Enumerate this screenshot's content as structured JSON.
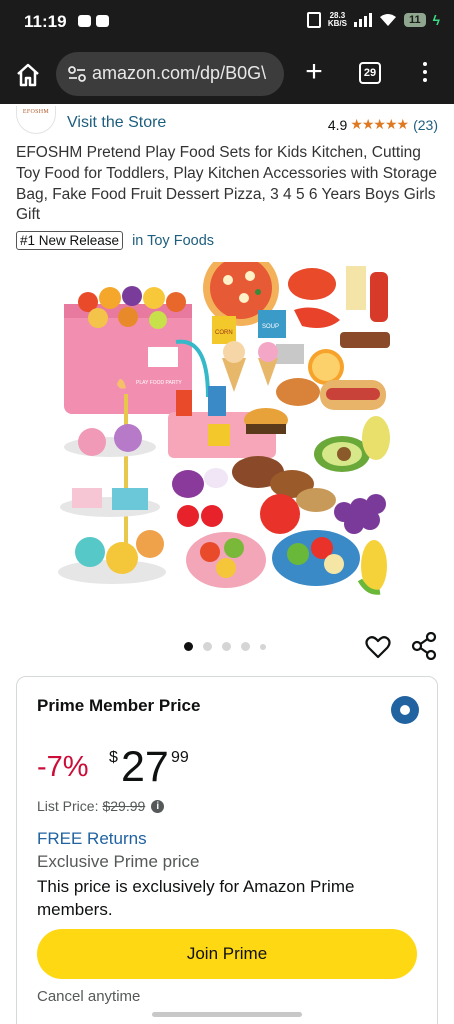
{
  "status_bar": {
    "time": "11:19",
    "net_speed_value": "28.3",
    "net_speed_unit": "KB/S",
    "battery": "11"
  },
  "browser": {
    "url": "amazon.com/dp/B0G\\",
    "tab_count": "29"
  },
  "store": {
    "logo_text": "EFOSHM",
    "visit_label": "Visit the Store",
    "rating_value": "4.9",
    "stars": "★★★★★",
    "rating_count": "(23)"
  },
  "product": {
    "title": "EFOSHM Pretend Play Food Sets for Kids Kitchen, Cutting Toy Food for Toddlers, Play Kitchen Accessories with Storage Bag, Fake Food Fruit Dessert Pizza, 3 4 5 6 Years Boys Girls Gift",
    "badge": "#1 New Release",
    "badge_category": "in Toy Foods",
    "image_bag_text": "PLAY FOOD PARTY",
    "image_can_text": "CORN",
    "image_can_text_2": "SOUP"
  },
  "offer": {
    "heading": "Prime Member Price",
    "discount": "-7%",
    "currency": "$",
    "price_whole": "27",
    "price_fraction": "99",
    "list_price_label": "List Price:",
    "list_price": "$29.99",
    "free_returns": "FREE Returns",
    "exclusive": "Exclusive Prime price",
    "exclusive_desc": "This price is exclusively for Amazon Prime members.",
    "join_label": "Join Prime",
    "cancel_label": "Cancel anytime"
  },
  "colors": {
    "price_red": "#cc0c39",
    "link_blue": "#1e5e7e",
    "join_yellow": "#ffd814",
    "star_orange": "#de7921"
  }
}
